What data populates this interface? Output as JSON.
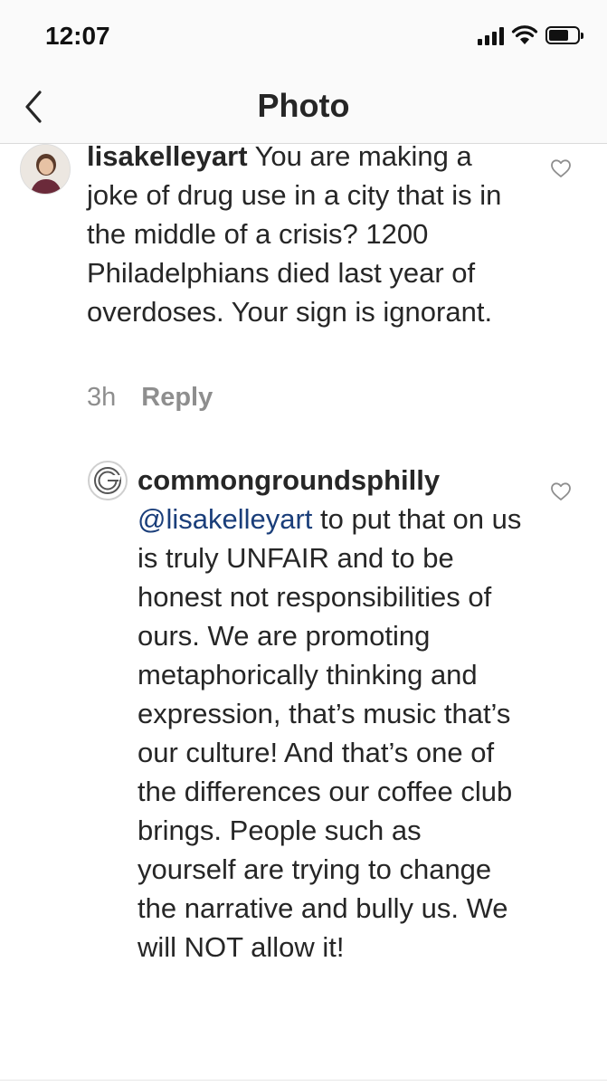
{
  "status_bar": {
    "time": "12:07",
    "icons": [
      "signal-icon",
      "wifi-icon",
      "battery-icon"
    ],
    "battery_level": 0.7
  },
  "nav": {
    "back_icon": "chevron-left-icon",
    "title": "Photo"
  },
  "comments": [
    {
      "username": "lisakelleyart",
      "text": "You are making a joke of drug use in a city that is in the middle of a crisis? 1200 Philadelphians died last year of overdoses. Your sign is ignorant.",
      "time": "3h",
      "reply_label": "Reply",
      "like_icon": "heart-outline-icon"
    },
    {
      "username": "commongroundsphilly",
      "mention": "@lisakelleyart",
      "text": "to put that on us is truly UNFAIR and to be honest not responsibilities of ours. We are promoting metaphorically thinking and expression, that’s music that’s our culture! And that’s one of the differences our coffee club brings. People such as yourself  are trying to change the narrative and bully us. We will NOT allow it!",
      "like_icon": "heart-outline-icon"
    }
  ],
  "colors": {
    "text": "#262626",
    "muted": "#8e8e8e",
    "mention": "#1a3e7a",
    "background": "#ffffff",
    "header_bg": "#fafafa"
  }
}
